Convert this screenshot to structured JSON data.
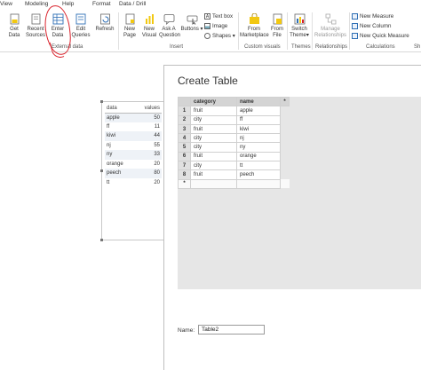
{
  "menubar": {
    "tabs": [
      "View",
      "Modeling",
      "Help",
      "Format",
      "Data / Drill"
    ]
  },
  "ribbon": {
    "buttons": {
      "get_data": "Get\nData",
      "recent_sources": "Recent\nSources",
      "enter_data": "Enter\nData",
      "edit_queries": "Edit\nQueries",
      "refresh": "Refresh",
      "new_page": "New\nPage",
      "new_visual": "New\nVisual",
      "ask_question": "Ask A\nQuestion",
      "buttons": "Buttons",
      "from_marketplace": "From\nMarketplace",
      "from_file": "From\nFile",
      "switch_theme": "Switch\nTheme",
      "manage_relationships": "Manage\nRelationships"
    },
    "small": {
      "text_box": "Text box",
      "image": "Image",
      "shapes": "Shapes",
      "new_measure": "New Measure",
      "new_column": "New Column",
      "new_quick_measure": "New Quick Measure"
    },
    "groups": {
      "external_data": "External data",
      "insert": "Insert",
      "custom_visuals": "Custom visuals",
      "themes": "Themes",
      "relationships": "Relationships",
      "calculations": "Calculations",
      "partial": "Sh"
    },
    "colors": {
      "accent": "#f2c811",
      "blue": "#2f6fb5",
      "annotation": "#d9202a"
    }
  },
  "visual": {
    "headers": [
      "data",
      "values"
    ],
    "rows": [
      [
        "apple",
        "50"
      ],
      [
        "ff",
        "11"
      ],
      [
        "kiwi",
        "44"
      ],
      [
        "nj",
        "55"
      ],
      [
        "ny",
        "33"
      ],
      [
        "orange",
        "20"
      ],
      [
        "peech",
        "80"
      ],
      [
        "tt",
        "20"
      ]
    ]
  },
  "dialog": {
    "title": "Create Table",
    "columns": [
      "category",
      "name"
    ],
    "add_column_glyph": "*",
    "rows": [
      [
        "1",
        "fruit",
        "apple"
      ],
      [
        "2",
        "city",
        "ff"
      ],
      [
        "3",
        "fruit",
        "kiwi"
      ],
      [
        "4",
        "city",
        "nj"
      ],
      [
        "5",
        "city",
        "ny"
      ],
      [
        "6",
        "fruit",
        "orange"
      ],
      [
        "7",
        "city",
        "tt"
      ],
      [
        "8",
        "fruit",
        "peech"
      ]
    ],
    "new_row_glyph": "*",
    "name_label": "Name:",
    "name_value": "Table2"
  }
}
